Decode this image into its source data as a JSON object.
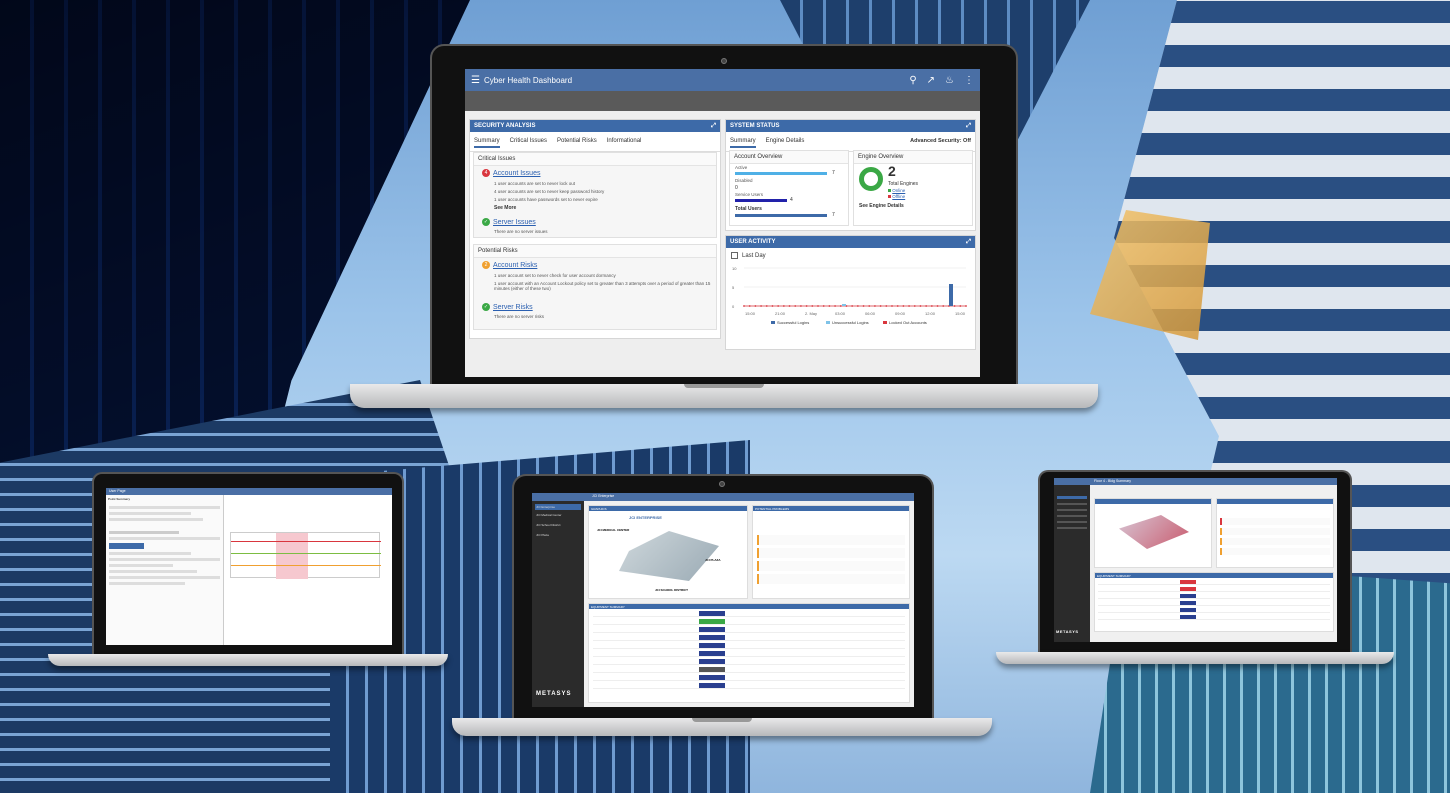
{
  "main_laptop": {
    "app_title": "Cyber Health Dashboard",
    "security": {
      "header": "SECURITY ANALYSIS",
      "tabs": [
        "Summary",
        "Critical Issues",
        "Potential Risks",
        "Informational"
      ],
      "critical_title": "Critical Issues",
      "account_issues": {
        "count": "4",
        "label": "Account Issues"
      },
      "critical_lines": [
        "1 user accounts are set to never lock out",
        "4 user accounts are set to never keep password history",
        "1 user accounts have passwords set to never expire"
      ],
      "see_more": "See More",
      "server_issues": {
        "label": "Server Issues",
        "note": "There are no server issues"
      },
      "risks_title": "Potential Risks",
      "account_risks": {
        "count": "2",
        "label": "Account Risks"
      },
      "risk_lines": [
        "1 user account set to never check for user account dormancy",
        "1 user account with an Account Lockout policy set to greater than 3 attempts over a period of greater than 15 minutes (either of these two)"
      ],
      "server_risks": {
        "label": "Server Risks",
        "note": "There are no server risks"
      }
    },
    "system": {
      "header": "SYSTEM STATUS",
      "tabs": [
        "Summary",
        "Engine Details"
      ],
      "advanced": "Advanced Security: Off",
      "account_overview": {
        "title": "Account Overview",
        "rows": [
          {
            "label": "Active",
            "value": "7"
          },
          {
            "label": "Disabled",
            "value": "0"
          },
          {
            "label": "Service Users",
            "value": "4"
          }
        ],
        "total_label": "Total Users",
        "total_value": "7"
      },
      "engine_overview": {
        "title": "Engine Overview",
        "count": "2",
        "label": "Total Engines",
        "online": "Online",
        "offline": "Offline",
        "link": "See Engine Details"
      }
    },
    "activity": {
      "header": "USER ACTIVITY",
      "range": "Last Day",
      "y_ticks": [
        "10",
        "5",
        "0"
      ],
      "x_ticks": [
        "15:00",
        "21:00",
        "2. May",
        "03:00",
        "06:00",
        "09:00",
        "12:00",
        "15:00"
      ],
      "legend": [
        "Successful Logins",
        "Unsuccessful Logins",
        "Locked Out Accounts"
      ],
      "colors": {
        "success": "#3d6aa8",
        "fail": "#7fc3e8",
        "locked": "#d9363e"
      }
    }
  },
  "center_laptop": {
    "title": "JCI Enterprise",
    "nav": [
      "JCI Enterprise",
      "JCI Medical Center",
      "JCI School District",
      "JCI Plaza"
    ],
    "graphics_header": "GRAPHICS",
    "map_title": "JCI ENTERPRISE",
    "map_labels": [
      "JCI MEDICAL CENTER",
      "JCI PLAZA",
      "JCI SCHOOL DISTRICT"
    ],
    "problems_header": "POTENTIAL PROBLEMS",
    "equipment_header": "EQUIPMENT SUMMARY",
    "brand": "METASYS"
  },
  "right_laptop": {
    "title": "Floor 4 - Bldg Summary",
    "brand": "METASYS",
    "equipment_header": "EQUIPMENT SUMMARY"
  },
  "left_laptop": {
    "title": "User Page",
    "panel_title": "Point Summary"
  }
}
